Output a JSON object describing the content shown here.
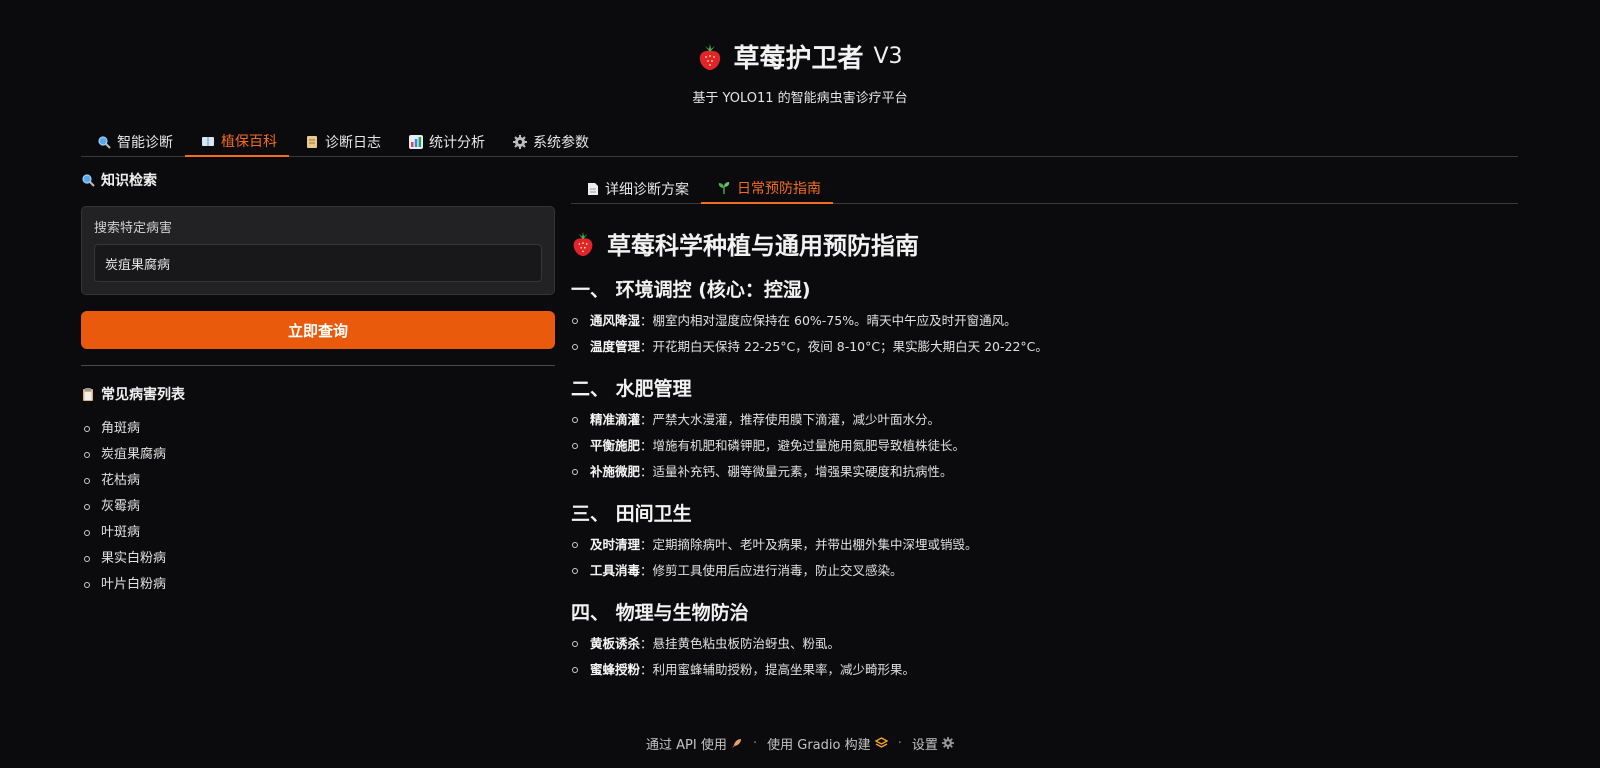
{
  "app": {
    "title": "草莓护卫者",
    "version": "V3",
    "subtitle": "基于 YOLO11 的智能病虫害诊疗平台"
  },
  "tabs": [
    {
      "label": "智能诊断",
      "icon": "magnifier-icon"
    },
    {
      "label": "植保百科",
      "icon": "book-icon",
      "active": true
    },
    {
      "label": "诊断日志",
      "icon": "scroll-icon"
    },
    {
      "label": "统计分析",
      "icon": "bar-chart-icon"
    },
    {
      "label": "系统参数",
      "icon": "gear-icon"
    }
  ],
  "left": {
    "search_title": "知识检索",
    "search_label": "搜索特定病害",
    "search_value": "炭疽果腐病",
    "query_button": "立即查询",
    "list_title": "常见病害列表",
    "diseases": [
      "角斑病",
      "炭疽果腐病",
      "花枯病",
      "灰霉病",
      "叶斑病",
      "果实白粉病",
      "叶片白粉病"
    ]
  },
  "right": {
    "subtabs": [
      {
        "label": "详细诊断方案",
        "icon": "document-icon"
      },
      {
        "label": "日常预防指南",
        "icon": "seedling-icon",
        "active": true
      }
    ],
    "guide_title": "草莓科学种植与通用预防指南",
    "sections": [
      {
        "heading": "一、 环境调控 (核心：控湿)",
        "items": [
          {
            "key": "通风降湿",
            "text": "：棚室内相对湿度应保持在 60%-75%。晴天中午应及时开窗通风。"
          },
          {
            "key": "温度管理",
            "text": "：开花期白天保持 22-25°C，夜间 8-10°C；果实膨大期白天 20-22°C。"
          }
        ]
      },
      {
        "heading": "二、 水肥管理",
        "items": [
          {
            "key": "精准滴灌",
            "text": "：严禁大水漫灌，推荐使用膜下滴灌，减少叶面水分。"
          },
          {
            "key": "平衡施肥",
            "text": "：增施有机肥和磷钾肥，避免过量施用氮肥导致植株徒长。"
          },
          {
            "key": "补施微肥",
            "text": "：适量补充钙、硼等微量元素，增强果实硬度和抗病性。"
          }
        ]
      },
      {
        "heading": "三、 田间卫生",
        "items": [
          {
            "key": "及时清理",
            "text": "：定期摘除病叶、老叶及病果，并带出棚外集中深埋或销毁。"
          },
          {
            "key": "工具消毒",
            "text": "：修剪工具使用后应进行消毒，防止交叉感染。"
          }
        ]
      },
      {
        "heading": "四、 物理与生物防治",
        "items": [
          {
            "key": "黄板诱杀",
            "text": "：悬挂黄色粘虫板防治蚜虫、粉虱。"
          },
          {
            "key": "蜜蜂授粉",
            "text": "：利用蜜蜂辅助授粉，提高坐果率，减少畸形果。"
          }
        ]
      }
    ]
  },
  "footer": {
    "api": "通过 API 使用",
    "gradio": "使用 Gradio 构建",
    "settings": "设置",
    "separator": "·"
  },
  "colors": {
    "accent": "#f36c1f",
    "button": "#ea5a0c",
    "background": "#0b0b0d"
  }
}
